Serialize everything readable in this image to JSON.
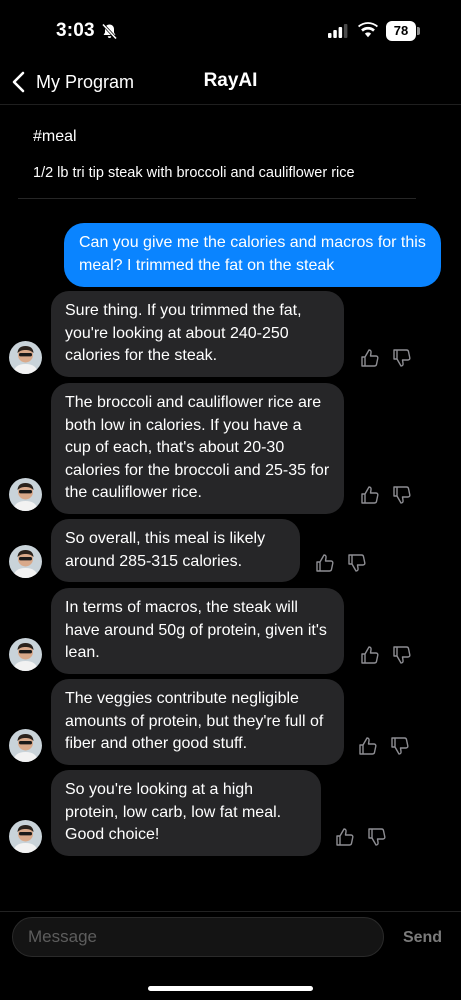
{
  "status": {
    "time": "3:03",
    "battery": "78",
    "icons": [
      "bell-slash-icon",
      "cellular-signal-icon",
      "wifi-icon",
      "battery-icon"
    ]
  },
  "nav": {
    "back_label": "My Program",
    "title": "RayAI",
    "back_icon": "chevron-left-icon"
  },
  "context": {
    "tag": "#meal",
    "meal": "1/2 lb tri tip steak with broccoli and cauliflower rice"
  },
  "messages": {
    "user": "Can you give me the calories and macros for this meal? I trimmed the fat on the steak",
    "ai": [
      "Sure thing. If you trimmed the fat, you're looking at about 240-250 calories for the steak.",
      "The broccoli and cauliflower rice are both low in calories. If you have a cup of each, that's about 20-30 calories for the broccoli and 25-35 for the cauliflower rice.",
      "So overall, this meal is likely around 285-315 calories.",
      "In terms of macros, the steak will have around 50g of protein, given it's lean.",
      "The veggies contribute negligible amounts of protein, but they're full of fiber and other good stuff.",
      "So you're looking at a high protein, low carb, low fat meal. Good choice!"
    ]
  },
  "composer": {
    "placeholder": "Message",
    "send_label": "Send"
  },
  "colors": {
    "background": "#000000",
    "user_bubble": "#0a84ff",
    "ai_bubble": "#262628",
    "send_disabled": "#7b7b7b"
  }
}
